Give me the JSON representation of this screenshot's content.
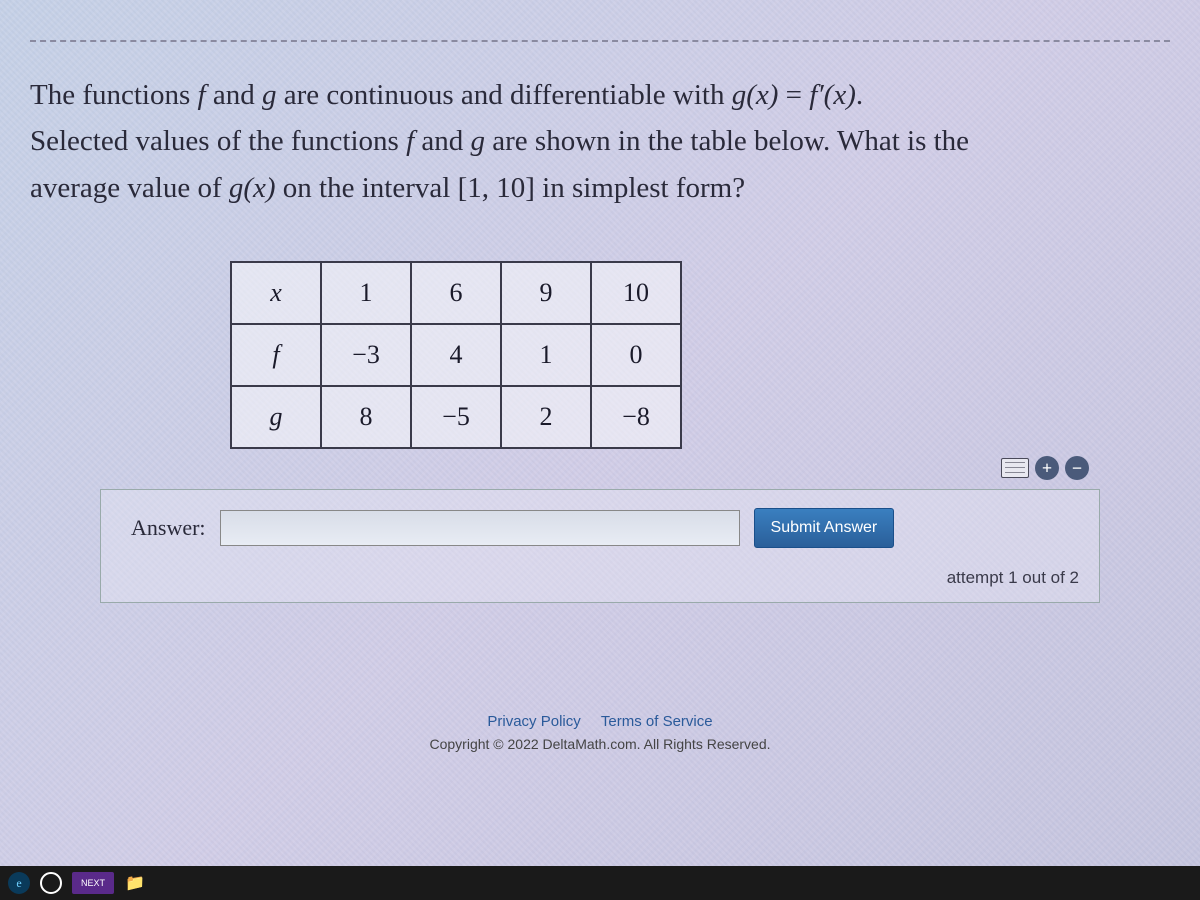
{
  "question": {
    "line1_pre": "The functions ",
    "f": "f",
    "and": " and ",
    "g": "g",
    "line1_mid": " are continuous and differentiable with ",
    "eq_lhs": "g(x)",
    "eq_eq": " = ",
    "eq_rhs": "f′(x)",
    "period": ".",
    "line2_pre": "Selected values of the functions ",
    "line2_mid": " are shown in the table below. What is the",
    "line3_pre": "average value of ",
    "gx": "g(x)",
    "line3_mid": " on the interval ",
    "interval": "[1, 10]",
    "line3_post": " in simplest form?"
  },
  "table": {
    "rows": [
      {
        "label": "x",
        "cells": [
          "1",
          "6",
          "9",
          "10"
        ]
      },
      {
        "label": "f",
        "cells": [
          "−3",
          "4",
          "1",
          "0"
        ]
      },
      {
        "label": "g",
        "cells": [
          "8",
          "−5",
          "2",
          "−8"
        ]
      }
    ]
  },
  "answer": {
    "label": "Answer:",
    "value": "",
    "submit": "Submit Answer",
    "attempt": "attempt 1 out of 2"
  },
  "toolbar": {
    "plus": "+",
    "minus": "−"
  },
  "footer": {
    "privacy": "Privacy Policy",
    "terms": "Terms of Service",
    "copyright": "Copyright © 2022 DeltaMath.com. All Rights Reserved."
  },
  "taskbar": {
    "app": "NEXT"
  }
}
